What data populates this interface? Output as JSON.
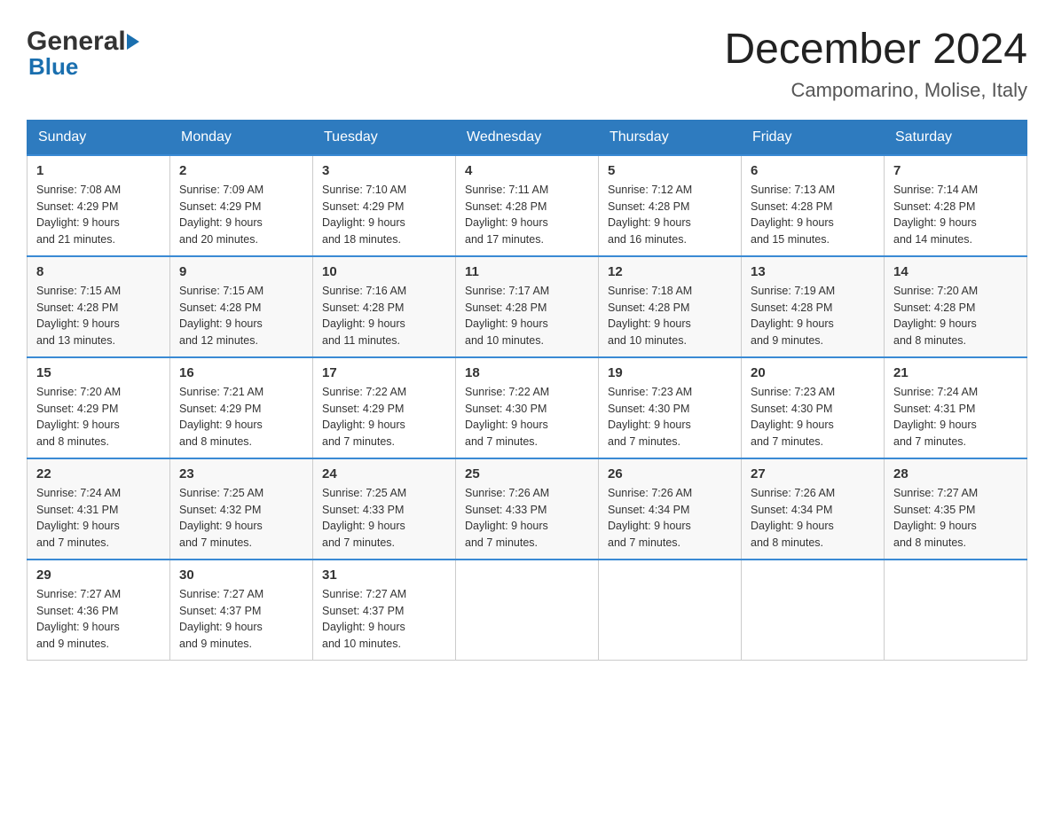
{
  "header": {
    "logo_general": "General",
    "logo_blue": "Blue",
    "month_title": "December 2024",
    "location": "Campomarino, Molise, Italy"
  },
  "calendar": {
    "days_of_week": [
      "Sunday",
      "Monday",
      "Tuesday",
      "Wednesday",
      "Thursday",
      "Friday",
      "Saturday"
    ],
    "weeks": [
      [
        {
          "day": "1",
          "sunrise": "7:08 AM",
          "sunset": "4:29 PM",
          "daylight": "9 hours and 21 minutes."
        },
        {
          "day": "2",
          "sunrise": "7:09 AM",
          "sunset": "4:29 PM",
          "daylight": "9 hours and 20 minutes."
        },
        {
          "day": "3",
          "sunrise": "7:10 AM",
          "sunset": "4:29 PM",
          "daylight": "9 hours and 18 minutes."
        },
        {
          "day": "4",
          "sunrise": "7:11 AM",
          "sunset": "4:28 PM",
          "daylight": "9 hours and 17 minutes."
        },
        {
          "day": "5",
          "sunrise": "7:12 AM",
          "sunset": "4:28 PM",
          "daylight": "9 hours and 16 minutes."
        },
        {
          "day": "6",
          "sunrise": "7:13 AM",
          "sunset": "4:28 PM",
          "daylight": "9 hours and 15 minutes."
        },
        {
          "day": "7",
          "sunrise": "7:14 AM",
          "sunset": "4:28 PM",
          "daylight": "9 hours and 14 minutes."
        }
      ],
      [
        {
          "day": "8",
          "sunrise": "7:15 AM",
          "sunset": "4:28 PM",
          "daylight": "9 hours and 13 minutes."
        },
        {
          "day": "9",
          "sunrise": "7:15 AM",
          "sunset": "4:28 PM",
          "daylight": "9 hours and 12 minutes."
        },
        {
          "day": "10",
          "sunrise": "7:16 AM",
          "sunset": "4:28 PM",
          "daylight": "9 hours and 11 minutes."
        },
        {
          "day": "11",
          "sunrise": "7:17 AM",
          "sunset": "4:28 PM",
          "daylight": "9 hours and 10 minutes."
        },
        {
          "day": "12",
          "sunrise": "7:18 AM",
          "sunset": "4:28 PM",
          "daylight": "9 hours and 10 minutes."
        },
        {
          "day": "13",
          "sunrise": "7:19 AM",
          "sunset": "4:28 PM",
          "daylight": "9 hours and 9 minutes."
        },
        {
          "day": "14",
          "sunrise": "7:20 AM",
          "sunset": "4:28 PM",
          "daylight": "9 hours and 8 minutes."
        }
      ],
      [
        {
          "day": "15",
          "sunrise": "7:20 AM",
          "sunset": "4:29 PM",
          "daylight": "9 hours and 8 minutes."
        },
        {
          "day": "16",
          "sunrise": "7:21 AM",
          "sunset": "4:29 PM",
          "daylight": "9 hours and 8 minutes."
        },
        {
          "day": "17",
          "sunrise": "7:22 AM",
          "sunset": "4:29 PM",
          "daylight": "9 hours and 7 minutes."
        },
        {
          "day": "18",
          "sunrise": "7:22 AM",
          "sunset": "4:30 PM",
          "daylight": "9 hours and 7 minutes."
        },
        {
          "day": "19",
          "sunrise": "7:23 AM",
          "sunset": "4:30 PM",
          "daylight": "9 hours and 7 minutes."
        },
        {
          "day": "20",
          "sunrise": "7:23 AM",
          "sunset": "4:30 PM",
          "daylight": "9 hours and 7 minutes."
        },
        {
          "day": "21",
          "sunrise": "7:24 AM",
          "sunset": "4:31 PM",
          "daylight": "9 hours and 7 minutes."
        }
      ],
      [
        {
          "day": "22",
          "sunrise": "7:24 AM",
          "sunset": "4:31 PM",
          "daylight": "9 hours and 7 minutes."
        },
        {
          "day": "23",
          "sunrise": "7:25 AM",
          "sunset": "4:32 PM",
          "daylight": "9 hours and 7 minutes."
        },
        {
          "day": "24",
          "sunrise": "7:25 AM",
          "sunset": "4:33 PM",
          "daylight": "9 hours and 7 minutes."
        },
        {
          "day": "25",
          "sunrise": "7:26 AM",
          "sunset": "4:33 PM",
          "daylight": "9 hours and 7 minutes."
        },
        {
          "day": "26",
          "sunrise": "7:26 AM",
          "sunset": "4:34 PM",
          "daylight": "9 hours and 7 minutes."
        },
        {
          "day": "27",
          "sunrise": "7:26 AM",
          "sunset": "4:34 PM",
          "daylight": "9 hours and 8 minutes."
        },
        {
          "day": "28",
          "sunrise": "7:27 AM",
          "sunset": "4:35 PM",
          "daylight": "9 hours and 8 minutes."
        }
      ],
      [
        {
          "day": "29",
          "sunrise": "7:27 AM",
          "sunset": "4:36 PM",
          "daylight": "9 hours and 9 minutes."
        },
        {
          "day": "30",
          "sunrise": "7:27 AM",
          "sunset": "4:37 PM",
          "daylight": "9 hours and 9 minutes."
        },
        {
          "day": "31",
          "sunrise": "7:27 AM",
          "sunset": "4:37 PM",
          "daylight": "9 hours and 10 minutes."
        },
        null,
        null,
        null,
        null
      ]
    ],
    "labels": {
      "sunrise": "Sunrise: ",
      "sunset": "Sunset: ",
      "daylight": "Daylight: "
    }
  }
}
